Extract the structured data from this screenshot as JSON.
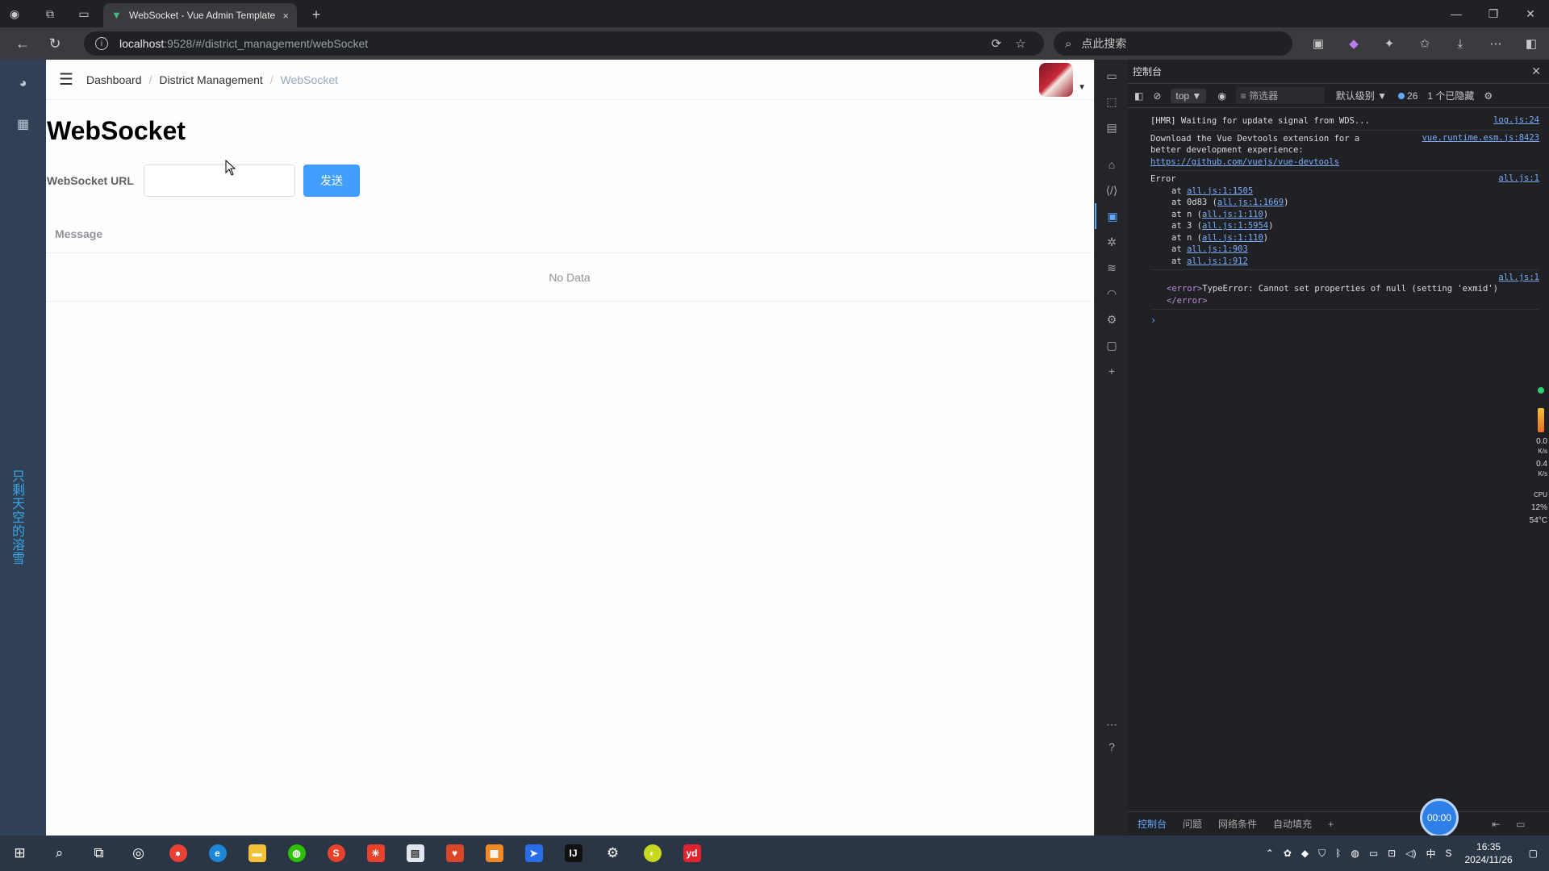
{
  "browser": {
    "tab_title": "WebSocket - Vue Admin Template",
    "tab_close": "×",
    "new_tab": "+",
    "url_host": "localhost",
    "url_path": ":9528/#/district_management/webSocket",
    "search_placeholder": "点此搜索"
  },
  "app": {
    "breadcrumb": [
      "Dashboard",
      "District Management",
      "WebSocket"
    ],
    "breadcrumb_sep": "/",
    "sidebar_vertical_text": "只剩天空的溶雪",
    "page_title": "WebSocket",
    "form": {
      "url_label": "WebSocket URL",
      "url_value": "",
      "send_label": "发送"
    },
    "table": {
      "column": "Message",
      "empty_text": "No Data"
    }
  },
  "devtools": {
    "title": "控制台",
    "context": "top",
    "filter_placeholder": "筛选器",
    "level": "默认级别",
    "issue_count": "26",
    "hidden_count": "1 个已隐藏",
    "logs": [
      {
        "text": "[HMR] Waiting for update signal from WDS...",
        "source": "log.js:24"
      },
      {
        "text": "Download the Vue Devtools extension for a",
        "text2": "better development experience:",
        "link": "https://github.com/vuejs/vue-devtools",
        "source": "vue.runtime.esm.js:8423"
      },
      {
        "text": "Error",
        "source": "all.js:1",
        "stack": [
          {
            "pre": "at ",
            "link": "all.js:1:1505",
            "post": ""
          },
          {
            "pre": "at 0d83 (",
            "link": "all.js:1:1669",
            "post": ")"
          },
          {
            "pre": "at n (",
            "link": "all.js:1:110",
            "post": ")"
          },
          {
            "pre": "at 3 (",
            "link": "all.js:1:5954",
            "post": ")"
          },
          {
            "pre": "at n (",
            "link": "all.js:1:110",
            "post": ")"
          },
          {
            "pre": "at ",
            "link": "all.js:1:903",
            "post": ""
          },
          {
            "pre": "at ",
            "link": "all.js:1:912",
            "post": ""
          }
        ]
      },
      {
        "source": "all.js:1",
        "err_open": "<error>",
        "err_text": "TypeError: Cannot set properties of null (setting 'exmid')",
        "err_close": "</error>"
      }
    ],
    "bottom_tabs": [
      "控制台",
      "问题",
      "网络条件",
      "自动填充"
    ],
    "timer": "00:00",
    "monitor": {
      "net_down": "0.0",
      "net_up": "0.4",
      "unit": "K/s",
      "cpu_label": "CPU",
      "cpu": "12%",
      "temp": "54°C"
    }
  },
  "taskbar": {
    "time": "16:35",
    "date": "2024/11/26",
    "ime": "中"
  }
}
